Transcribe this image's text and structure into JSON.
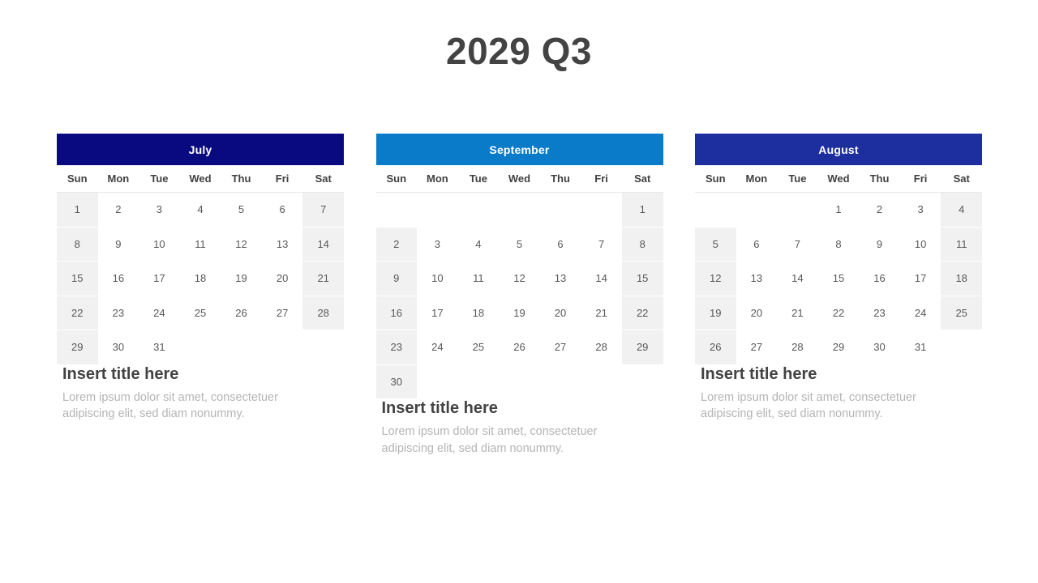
{
  "slide": {
    "title": "2029 Q3",
    "title_color": "#434343",
    "background": "#ffffff"
  },
  "weekday_headers": [
    "Sun",
    "Mon",
    "Tue",
    "Wed",
    "Thu",
    "Fri",
    "Sat"
  ],
  "calendars": [
    {
      "month": "July",
      "header_color": "#0a0a80",
      "first_day_index": 0,
      "days_in_month": 31,
      "weeks": [
        [
          "1",
          "2",
          "3",
          "4",
          "5",
          "6",
          "7"
        ],
        [
          "8",
          "9",
          "10",
          "11",
          "12",
          "13",
          "14"
        ],
        [
          "15",
          "16",
          "17",
          "18",
          "19",
          "20",
          "21"
        ],
        [
          "22",
          "23",
          "24",
          "25",
          "26",
          "27",
          "28"
        ],
        [
          "29",
          "30",
          "31",
          "",
          "",
          "",
          ""
        ]
      ],
      "caption": {
        "title": "Insert title here",
        "body": "Lorem ipsum dolor sit amet, consectetuer adipiscing elit, sed diam nonummy."
      }
    },
    {
      "month": "September",
      "header_color": "#0a7bc8",
      "first_day_index": 6,
      "days_in_month": 30,
      "weeks": [
        [
          "",
          "",
          "",
          "",
          "",
          "",
          "1"
        ],
        [
          "2",
          "3",
          "4",
          "5",
          "6",
          "7",
          "8"
        ],
        [
          "9",
          "10",
          "11",
          "12",
          "13",
          "14",
          "15"
        ],
        [
          "16",
          "17",
          "18",
          "19",
          "20",
          "21",
          "22"
        ],
        [
          "23",
          "24",
          "25",
          "26",
          "27",
          "28",
          "29"
        ],
        [
          "30",
          "",
          "",
          "",
          "",
          "",
          ""
        ]
      ],
      "caption": {
        "title": "Insert title here",
        "body": "Lorem ipsum dolor sit amet, consectetuer adipiscing elit, sed diam nonummy."
      }
    },
    {
      "month": "August",
      "header_color": "#1d2f9e",
      "first_day_index": 3,
      "days_in_month": 31,
      "weeks": [
        [
          "",
          "",
          "",
          "1",
          "2",
          "3",
          "4"
        ],
        [
          "5",
          "6",
          "7",
          "8",
          "9",
          "10",
          "11"
        ],
        [
          "12",
          "13",
          "14",
          "15",
          "16",
          "17",
          "18"
        ],
        [
          "19",
          "20",
          "21",
          "22",
          "23",
          "24",
          "25"
        ],
        [
          "26",
          "27",
          "28",
          "29",
          "30",
          "31",
          ""
        ]
      ],
      "caption": {
        "title": "Insert title here",
        "body": "Lorem ipsum dolor sit amet, consectetuer adipiscing elit, sed diam nonummy."
      }
    }
  ],
  "colors": {
    "weekend_cell": "#f1f1f1",
    "date_text": "#585858",
    "dayname_text": "#404040",
    "caption_title": "#434343",
    "caption_body": "#b4b4b4"
  }
}
